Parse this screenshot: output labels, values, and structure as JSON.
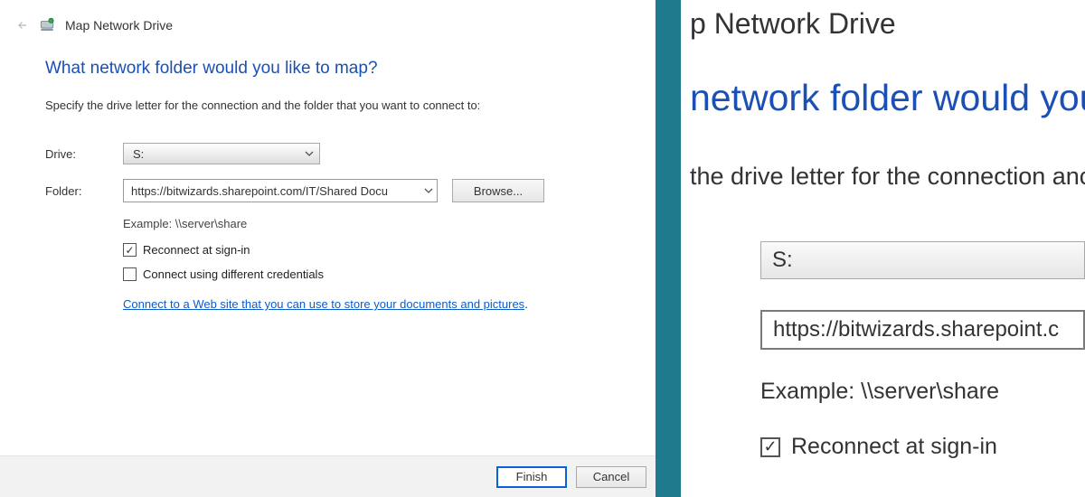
{
  "dialog": {
    "title": "Map Network Drive",
    "heading": "What network folder would you like to map?",
    "instruction": "Specify the drive letter for the connection and the folder that you want to connect to:",
    "drive_label": "Drive:",
    "drive_value": "S:",
    "folder_label": "Folder:",
    "folder_value": "https://bitwizards.sharepoint.com/IT/Shared Docu",
    "browse": "Browse...",
    "example": "Example: \\\\server\\share",
    "reconnect_label": "Reconnect at sign-in",
    "reconnect_checked": true,
    "diff_creds_label": "Connect using different credentials",
    "diff_creds_checked": false,
    "website_link": "Connect to a Web site that you can use to store your documents and pictures",
    "finish": "Finish",
    "cancel": "Cancel"
  },
  "zoom": {
    "title_fragment": "p Network Drive",
    "heading_fragment": " network folder would you lik",
    "instruction_fragment": " the drive letter for the connection anc",
    "drive_value": "S:",
    "folder_value": "https://bitwizards.sharepoint.c",
    "example": "Example: \\\\server\\share",
    "reconnect_label": "Reconnect at sign-in"
  }
}
